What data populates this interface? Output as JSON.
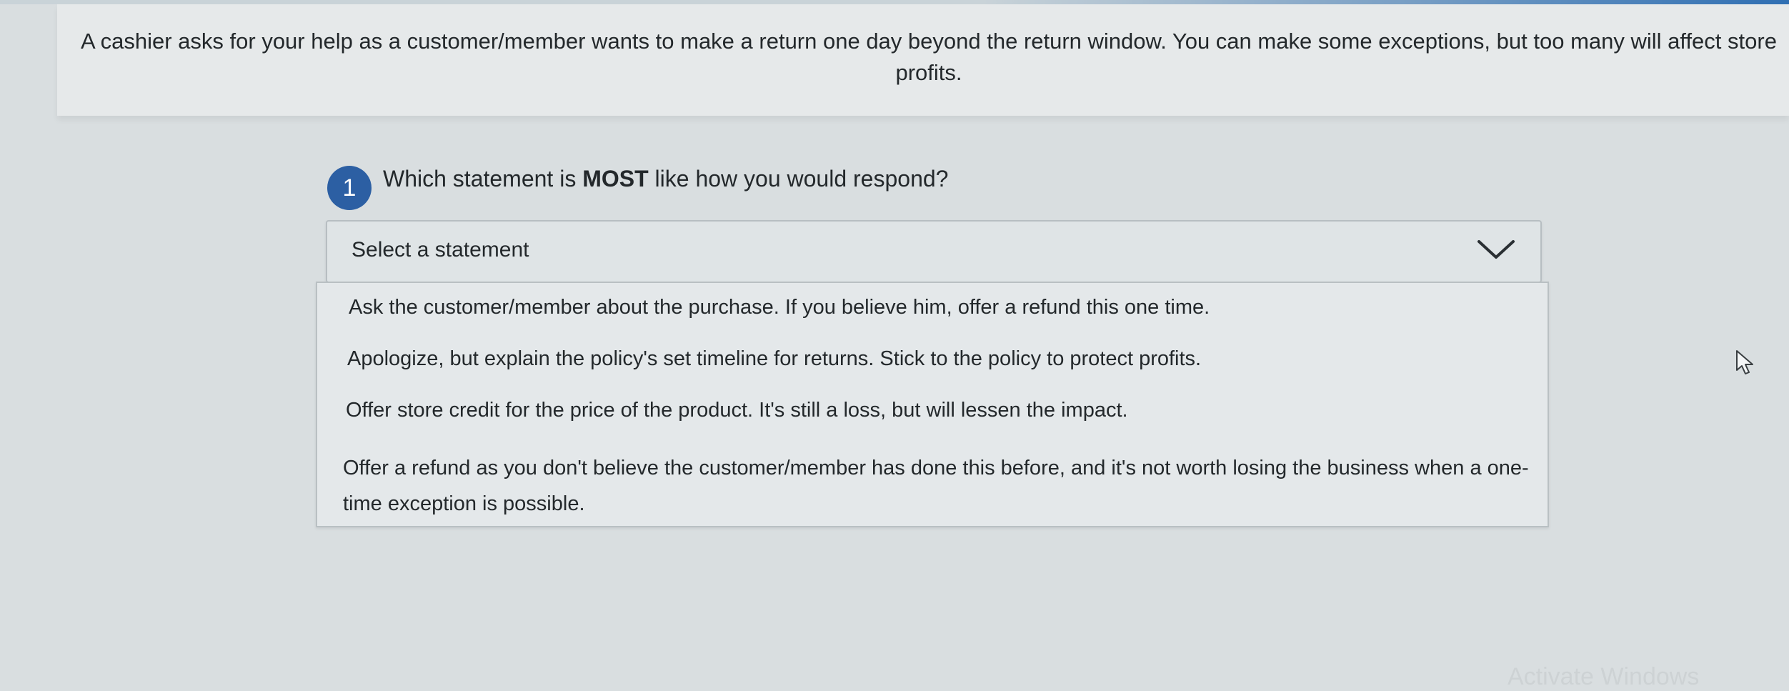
{
  "scenario": {
    "text": "A cashier asks for your help as a customer/member wants to make a return one day beyond the return window. You can make some exceptions, but too many will affect store profits."
  },
  "question": {
    "number": "1",
    "text_before": "Which statement is ",
    "text_bold": "MOST",
    "text_after": " like how you would respond?"
  },
  "select": {
    "value": "Select a statement",
    "icon": "chevron-down-icon",
    "options": [
      "Ask the customer/member about the purchase. If you believe him, offer a refund this one time.",
      "Apologize, but explain the policy's set timeline for returns. Stick to the policy to protect profits.",
      "Offer store credit for the price of the product. It's still a loss, but will lessen the impact.",
      "Offer a refund as you don't believe the customer/member has done this before, and it's not worth losing the business when a one-time exception is possible."
    ]
  },
  "watermark": {
    "text": "Activate Windows"
  },
  "colors": {
    "accent": "#2c5fa3",
    "background": "#d9dee0",
    "panel": "#e6e9ea"
  }
}
